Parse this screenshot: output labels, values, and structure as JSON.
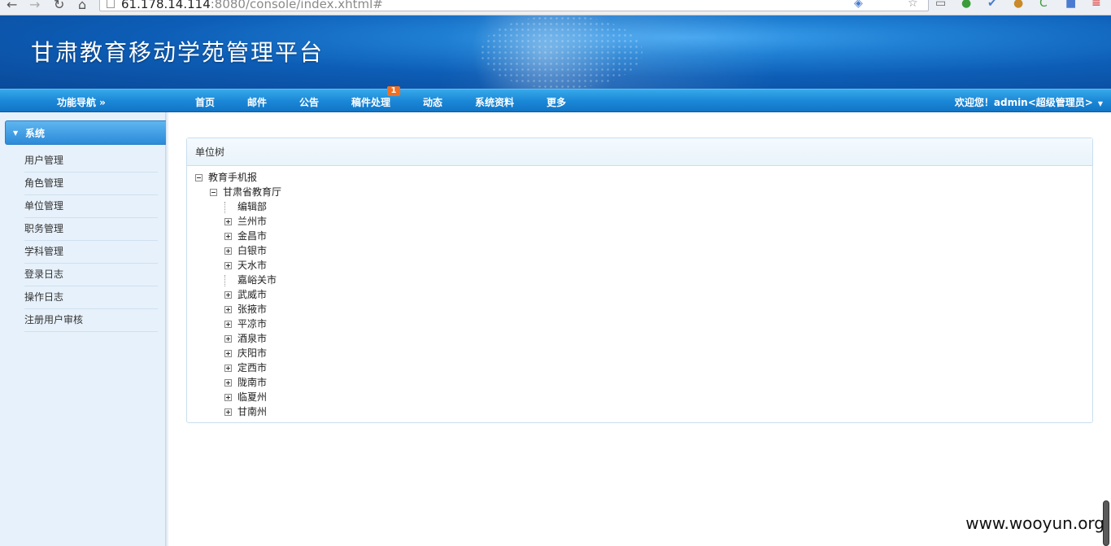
{
  "browser": {
    "url_host": "61.178.14.114",
    "url_rest": ":8080/console/index.xhtml#"
  },
  "banner": {
    "title": "甘肃教育移动学苑管理平台"
  },
  "navbar": {
    "nav_label": "功能导航 »",
    "items": [
      {
        "label": "首页"
      },
      {
        "label": "邮件"
      },
      {
        "label": "公告"
      },
      {
        "label": "稿件处理",
        "badge": "1"
      },
      {
        "label": "动态"
      },
      {
        "label": "系统资料"
      },
      {
        "label": "更多"
      }
    ],
    "welcome": "欢迎您！admin<超级管理员>"
  },
  "sidebar": {
    "section": "系统",
    "items": [
      {
        "label": "用户管理"
      },
      {
        "label": "角色管理"
      },
      {
        "label": "单位管理"
      },
      {
        "label": "职务管理"
      },
      {
        "label": "学科管理"
      },
      {
        "label": "登录日志"
      },
      {
        "label": "操作日志"
      },
      {
        "label": "注册用户审核"
      }
    ]
  },
  "panel": {
    "title": "单位树",
    "tree": [
      {
        "label": "教育手机报",
        "level": 0,
        "toggle": "minus"
      },
      {
        "label": "甘肃省教育厅",
        "level": 1,
        "toggle": "minus"
      },
      {
        "label": "编辑部",
        "level": 2,
        "toggle": "leaf"
      },
      {
        "label": "兰州市",
        "level": 2,
        "toggle": "plus"
      },
      {
        "label": "金昌市",
        "level": 2,
        "toggle": "plus"
      },
      {
        "label": "白银市",
        "level": 2,
        "toggle": "plus"
      },
      {
        "label": "天水市",
        "level": 2,
        "toggle": "plus"
      },
      {
        "label": "嘉峪关市",
        "level": 2,
        "toggle": "leaf"
      },
      {
        "label": "武威市",
        "level": 2,
        "toggle": "plus"
      },
      {
        "label": "张掖市",
        "level": 2,
        "toggle": "plus"
      },
      {
        "label": "平凉市",
        "level": 2,
        "toggle": "plus"
      },
      {
        "label": "酒泉市",
        "level": 2,
        "toggle": "plus"
      },
      {
        "label": "庆阳市",
        "level": 2,
        "toggle": "plus"
      },
      {
        "label": "定西市",
        "level": 2,
        "toggle": "plus"
      },
      {
        "label": "陇南市",
        "level": 2,
        "toggle": "plus"
      },
      {
        "label": "临夏州",
        "level": 2,
        "toggle": "plus"
      },
      {
        "label": "甘南州",
        "level": 2,
        "toggle": "plus"
      }
    ]
  },
  "watermark": "www.wooyun.org"
}
